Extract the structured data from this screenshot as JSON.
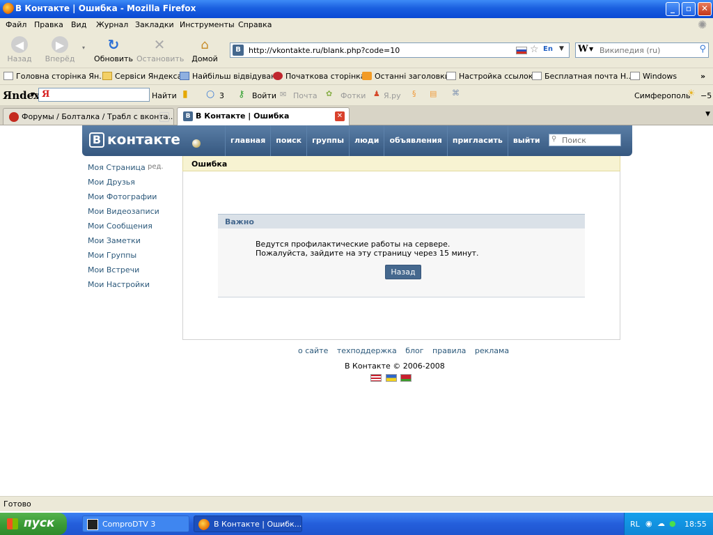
{
  "window": {
    "title": "В Контакте | Ошибка - Mozilla Firefox"
  },
  "menu": [
    "Файл",
    "Правка",
    "Вид",
    "Журнал",
    "Закладки",
    "Инструменты",
    "Справка"
  ],
  "nav": {
    "back": "Назад",
    "forward": "Вперёд",
    "reload": "Обновить",
    "stop": "Остановить",
    "home": "Домой",
    "url": "http://vkontakte.ru/blank.php?code=10",
    "lang": "En",
    "search_engine_icon": "W",
    "search_placeholder": "Википедия (ru)"
  },
  "bookmarks": [
    "Головна сторінка Ян...",
    "Сервіси Яндекса",
    "Найбільш відвідувані",
    "Початкова сторінка",
    "Останні заголовки",
    "Настройка ссылок",
    "Бесплатная почта Н...",
    "Windows"
  ],
  "yandex": {
    "logo": "Яndex",
    "input_mark": "Я",
    "find": "Найти",
    "count": "3",
    "login": "Войти",
    "mail": "Почта",
    "photos": "Фотки",
    "yaru": "Я.ру",
    "city": "Симферополь",
    "temp": "−5"
  },
  "tabs": [
    {
      "label": "Форумы / Болталка / Трабл с вконта...",
      "active": false
    },
    {
      "label": "В Контакте | Ошибка",
      "active": true
    }
  ],
  "vk": {
    "logo": "контакте",
    "logo_letter": "В",
    "nav": [
      "главная",
      "поиск",
      "группы",
      "люди",
      "объявления",
      "пригласить",
      "выйти"
    ],
    "search_placeholder": "Поиск",
    "left_menu": [
      "Моя Страница",
      "Мои Друзья",
      "Мои Фотографии",
      "Мои Видеозаписи",
      "Мои Сообщения",
      "Мои Заметки",
      "Мои Группы",
      "Мои Встречи",
      "Мои Настройки"
    ],
    "edit_label": "ред.",
    "error_title": "Ошибка",
    "important_title": "Важно",
    "message_line1": "Ведутся профилактические работы на сервере.",
    "message_line2": "Пожалуйста, зайдите на эту страницу через 15 минут.",
    "back_button": "Назад",
    "footer_links": [
      "о сайте",
      "техподдержка",
      "блог",
      "правила",
      "реклама"
    ],
    "copyright": "В Контакте © 2006-2008"
  },
  "status": "Готово",
  "taskbar": {
    "start": "пуск",
    "tasks": [
      "ComproDTV 3",
      "В Контакте | Ошибк..."
    ],
    "lang": "RL",
    "clock": "18:55"
  },
  "colors": {
    "vk_blue": "#45688e",
    "link": "#2b587a",
    "error_bg": "#f7f3d2",
    "taskbar": "#245edb"
  }
}
